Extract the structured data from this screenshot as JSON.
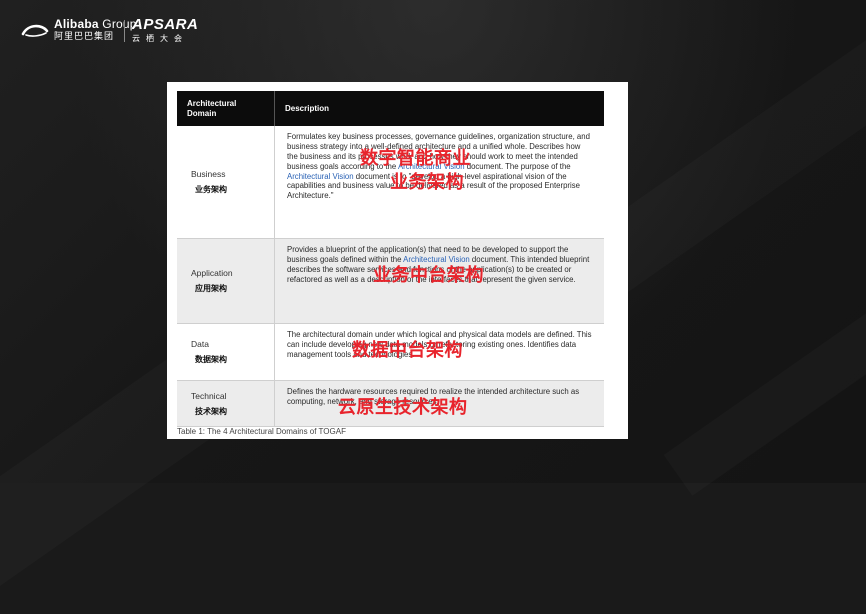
{
  "header": {
    "alibaba_en_bold": "Alibaba",
    "alibaba_en_light": " Group",
    "alibaba_cn": "阿里巴巴集团",
    "apsara_en": "APSARA",
    "apsara_cn": "云栖大会"
  },
  "table": {
    "headers": [
      "Architectural Domain",
      "Description"
    ],
    "rows": [
      {
        "domain_en": "Business",
        "domain_cn": "业务架构",
        "desc_parts": [
          {
            "text": "Formulates key business processes, governance guidelines, organization structure, and business strategy into a well-defined architecture and a unified whole. Describes how the business and its processes work and how they should work to meet the intended business goals according to the "
          },
          {
            "text": "Architectural Vision",
            "link": true
          },
          {
            "text": " document. The purpose of the "
          },
          {
            "text": "Architectural Vision",
            "link": true
          },
          {
            "text": " document is to \"develop a high-level aspirational vision of the capabilities and business value to be delivered as a result of the proposed Enterprise Architecture.\""
          }
        ],
        "overlay": [
          "数字智能商业",
          "业务架构"
        ]
      },
      {
        "domain_en": "Application",
        "domain_cn": "应用架构",
        "desc_parts": [
          {
            "text": "Provides a blueprint of the application(s) that need to be developed to support the business goals defined within the "
          },
          {
            "text": "Architectural Vision",
            "link": true
          },
          {
            "text": " document. This intended blueprint describes the software services and functions of the application(s) to be created or refactored as well as a description of the interfaces that represent the given service."
          }
        ],
        "overlay": [
          "业务中台架构"
        ]
      },
      {
        "domain_en": "Data",
        "domain_cn": "数据架构",
        "desc_parts": [
          {
            "text": "The architectural domain under which logical and physical data models are defined. This can include developing new data models or refactoring existing ones. Identifies data management tools and technologies."
          }
        ],
        "overlay": [
          "数据中台架构"
        ]
      },
      {
        "domain_en": "Technical",
        "domain_cn": "技术架构",
        "desc_parts": [
          {
            "text": "Defines the hardware resources required to realize the intended architecture such as computing, network, and storage resources."
          }
        ],
        "overlay": [
          "云原生技术架构"
        ]
      }
    ],
    "caption": "Table 1: The 4 Architectural Domains of TOGAF"
  },
  "colors": {
    "overlay_red": "#e8242c",
    "link_blue": "#2a62b5",
    "header_black": "#0c0c0c"
  }
}
